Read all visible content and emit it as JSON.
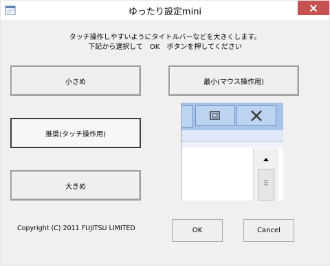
{
  "window": {
    "title": "ゆったり設定mini"
  },
  "instructions": {
    "line1": "タッチ操作しやすいようにタイトルバーなどを大きくします。",
    "line2": "下記から選択して　OK　ボタンを押してください"
  },
  "options": {
    "small": "小さめ",
    "recommended": "推奨(タッチ操作用)",
    "large": "大きめ",
    "minimum": "最小(マウス操作用)"
  },
  "footer": {
    "copyright": "Copyright (C) 2011 FUJITSU LIMITED",
    "ok": "OK",
    "cancel": "Cancel"
  },
  "icons": {
    "app": "app-window-icon",
    "close": "close-icon",
    "preview_max": "maximize-icon",
    "preview_close": "close-icon",
    "scroll_up": "scroll-up-icon",
    "scroll_thumb": "scroll-thumb-grip-icon"
  },
  "colors": {
    "close_button": "#c75050",
    "preview_titlebar": "#a8c4ea",
    "preview_button": "#bcd3f2",
    "dialog_background": "#f0f0f0"
  }
}
